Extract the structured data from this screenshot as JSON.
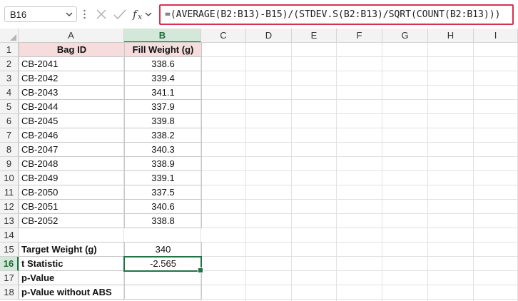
{
  "formula_bar": {
    "name_box": "B16",
    "formula": "=(AVERAGE(B2:B13)-B15)/(STDEV.S(B2:B13)/SQRT(COUNT(B2:B13)))"
  },
  "columns": [
    "A",
    "B",
    "C",
    "D",
    "E",
    "F",
    "G",
    "H",
    "I"
  ],
  "rows": [
    "1",
    "2",
    "3",
    "4",
    "5",
    "6",
    "7",
    "8",
    "9",
    "10",
    "11",
    "12",
    "13",
    "14",
    "15",
    "16",
    "17",
    "18"
  ],
  "table": {
    "header": {
      "bag_id": "Bag ID",
      "fill_weight": "Fill Weight (g)"
    },
    "data": [
      {
        "bag": "CB-2041",
        "weight": "338.6"
      },
      {
        "bag": "CB-2042",
        "weight": "339.4"
      },
      {
        "bag": "CB-2043",
        "weight": "341.1"
      },
      {
        "bag": "CB-2044",
        "weight": "337.9"
      },
      {
        "bag": "CB-2045",
        "weight": "339.8"
      },
      {
        "bag": "CB-2046",
        "weight": "338.2"
      },
      {
        "bag": "CB-2047",
        "weight": "340.3"
      },
      {
        "bag": "CB-2048",
        "weight": "338.9"
      },
      {
        "bag": "CB-2049",
        "weight": "339.1"
      },
      {
        "bag": "CB-2050",
        "weight": "337.5"
      },
      {
        "bag": "CB-2051",
        "weight": "340.6"
      },
      {
        "bag": "CB-2052",
        "weight": "338.8"
      }
    ]
  },
  "summary": [
    {
      "label": "Target Weight (g)",
      "value": "340"
    },
    {
      "label": "t Statistic",
      "value": "-2.565"
    },
    {
      "label": "p-Value",
      "value": ""
    },
    {
      "label": "p-Value without ABS",
      "value": ""
    }
  ],
  "selection": {
    "column": "B",
    "row": "16"
  },
  "colors": {
    "header_fill": "#f6dcdc",
    "selection": "#217346",
    "formula_border": "#d9304f"
  }
}
